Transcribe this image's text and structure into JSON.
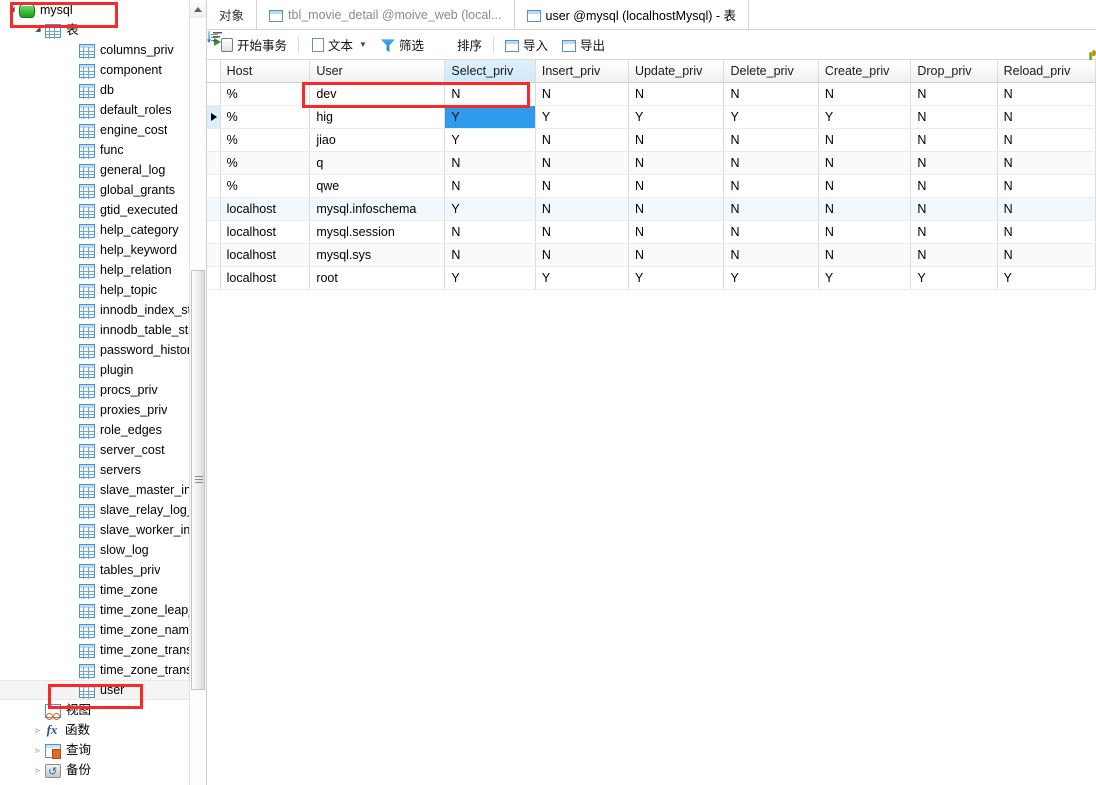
{
  "sidebar": {
    "root": {
      "label": "mysql",
      "icon": "database-icon",
      "expanded": true
    },
    "tables_group": {
      "label": "表",
      "icon": "table-icon",
      "expanded": true
    },
    "tables": [
      "columns_priv",
      "component",
      "db",
      "default_roles",
      "engine_cost",
      "func",
      "general_log",
      "global_grants",
      "gtid_executed",
      "help_category",
      "help_keyword",
      "help_relation",
      "help_topic",
      "innodb_index_stats",
      "innodb_table_stats",
      "password_history",
      "plugin",
      "procs_priv",
      "proxies_priv",
      "role_edges",
      "server_cost",
      "servers",
      "slave_master_info",
      "slave_relay_log_info",
      "slave_worker_info",
      "slow_log",
      "tables_priv",
      "time_zone",
      "time_zone_leap_second",
      "time_zone_name",
      "time_zone_transition",
      "time_zone_transition_type",
      "user"
    ],
    "selected_table": "user",
    "groups": [
      {
        "label": "视图",
        "icon": "view-icon",
        "expandable": false
      },
      {
        "label": "函数",
        "icon": "function-icon",
        "expandable": true
      },
      {
        "label": "查询",
        "icon": "query-icon",
        "expandable": true
      },
      {
        "label": "备份",
        "icon": "backup-icon",
        "expandable": true
      }
    ],
    "scroll_up_icon": "scroll-up-arrow-icon"
  },
  "tabs": [
    {
      "label": "对象",
      "icon": null,
      "active": false,
      "dim": false
    },
    {
      "label": "tbl_movie_detail @moive_web (local...",
      "icon": "table-icon",
      "active": false,
      "dim": true
    },
    {
      "label": "user @mysql (localhostMysql) - 表",
      "icon": "table-icon",
      "active": true,
      "dim": false
    }
  ],
  "toolbar": [
    {
      "label": "开始事务",
      "icon": "begin-transaction-icon",
      "caret": false
    },
    {
      "sep": true
    },
    {
      "label": "文本",
      "icon": "text-icon",
      "caret": true
    },
    {
      "label": "筛选",
      "icon": "filter-icon",
      "caret": false
    },
    {
      "label": "排序",
      "icon": "sort-icon",
      "caret": false
    },
    {
      "sep": true
    },
    {
      "label": "导入",
      "icon": "import-icon",
      "caret": false
    },
    {
      "label": "导出",
      "icon": "export-icon",
      "caret": false
    }
  ],
  "grid": {
    "columns": [
      "Host",
      "User",
      "Select_priv",
      "Insert_priv",
      "Update_priv",
      "Delete_priv",
      "Create_priv",
      "Drop_priv",
      "Reload_priv"
    ],
    "highlighted_column": "Select_priv",
    "selected_row_index": 1,
    "selected_cell": {
      "row": 1,
      "column": "Select_priv",
      "value": "Y"
    },
    "rows": [
      {
        "Host": "%",
        "User": "dev",
        "Select_priv": "N",
        "Insert_priv": "N",
        "Update_priv": "N",
        "Delete_priv": "N",
        "Create_priv": "N",
        "Drop_priv": "N",
        "Reload_priv": "N"
      },
      {
        "Host": "%",
        "User": "hig",
        "Select_priv": "Y",
        "Insert_priv": "Y",
        "Update_priv": "Y",
        "Delete_priv": "Y",
        "Create_priv": "Y",
        "Drop_priv": "N",
        "Reload_priv": "N"
      },
      {
        "Host": "%",
        "User": "jiao",
        "Select_priv": "Y",
        "Insert_priv": "N",
        "Update_priv": "N",
        "Delete_priv": "N",
        "Create_priv": "N",
        "Drop_priv": "N",
        "Reload_priv": "N"
      },
      {
        "Host": "%",
        "User": "q",
        "Select_priv": "N",
        "Insert_priv": "N",
        "Update_priv": "N",
        "Delete_priv": "N",
        "Create_priv": "N",
        "Drop_priv": "N",
        "Reload_priv": "N"
      },
      {
        "Host": "%",
        "User": "qwe",
        "Select_priv": "N",
        "Insert_priv": "N",
        "Update_priv": "N",
        "Delete_priv": "N",
        "Create_priv": "N",
        "Drop_priv": "N",
        "Reload_priv": "N"
      },
      {
        "Host": "localhost",
        "User": "mysql.infoschema",
        "Select_priv": "Y",
        "Insert_priv": "N",
        "Update_priv": "N",
        "Delete_priv": "N",
        "Create_priv": "N",
        "Drop_priv": "N",
        "Reload_priv": "N"
      },
      {
        "Host": "localhost",
        "User": "mysql.session",
        "Select_priv": "N",
        "Insert_priv": "N",
        "Update_priv": "N",
        "Delete_priv": "N",
        "Create_priv": "N",
        "Drop_priv": "N",
        "Reload_priv": "N"
      },
      {
        "Host": "localhost",
        "User": "mysql.sys",
        "Select_priv": "N",
        "Insert_priv": "N",
        "Update_priv": "N",
        "Delete_priv": "N",
        "Create_priv": "N",
        "Drop_priv": "N",
        "Reload_priv": "N"
      },
      {
        "Host": "localhost",
        "User": "root",
        "Select_priv": "Y",
        "Insert_priv": "Y",
        "Update_priv": "Y",
        "Delete_priv": "Y",
        "Create_priv": "Y",
        "Drop_priv": "Y",
        "Reload_priv": "Y"
      }
    ]
  },
  "annotations": {
    "highlight_color": "#fb2828",
    "boxes": [
      {
        "name": "mysql-db-highlight"
      },
      {
        "name": "user-table-highlight"
      },
      {
        "name": "hig-row-cell-highlight"
      }
    ]
  },
  "colors": {
    "selection_blue": "#2f9bec",
    "header_highlight": "#cfe9f9",
    "accent_red": "#fb2828"
  }
}
